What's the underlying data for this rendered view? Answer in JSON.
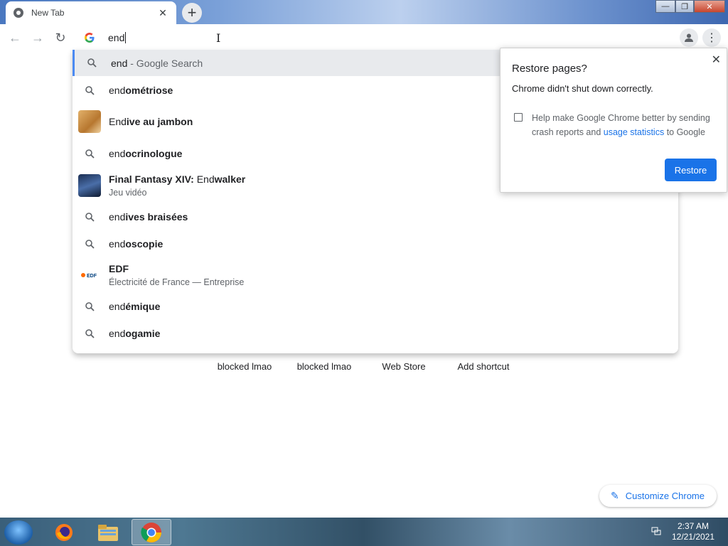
{
  "tab": {
    "title": "New Tab",
    "close": "✕",
    "new_tab": "+"
  },
  "window": {
    "minimize": "—",
    "maximize": "❐",
    "close": "✕"
  },
  "toolbar": {
    "back": "←",
    "forward": "→",
    "reload": "↻",
    "menu": "⋮"
  },
  "omnibox": {
    "value": "end"
  },
  "suggestions": [
    {
      "icon": "search-icon",
      "prefix": "end",
      "bold": "",
      "suffix": " - Google Search",
      "sub": ""
    },
    {
      "icon": "search-icon",
      "prefix": "end",
      "bold": "ométriose",
      "suffix": "",
      "sub": ""
    },
    {
      "icon": "food-thumbnail",
      "prefix": "End",
      "bold": "ive au jambon",
      "suffix": "",
      "sub": ""
    },
    {
      "icon": "search-icon",
      "prefix": "end",
      "bold": "ocrinologue",
      "suffix": "",
      "sub": ""
    },
    {
      "icon": "game-thumbnail",
      "prefix": "Final Fantasy XIV: ",
      "bold": "",
      "suffix": "",
      "bold2_pre": "End",
      "bold2": "walker",
      "sub": "Jeu vidéo"
    },
    {
      "icon": "search-icon",
      "prefix": "end",
      "bold": "ives braisées",
      "suffix": "",
      "sub": ""
    },
    {
      "icon": "search-icon",
      "prefix": "end",
      "bold": "oscopie",
      "suffix": "",
      "sub": ""
    },
    {
      "icon": "edf-logo",
      "prefix": "EDF",
      "bold": "",
      "suffix": "",
      "sub": "Électricité de France — Entreprise"
    },
    {
      "icon": "search-icon",
      "prefix": "end",
      "bold": "émique",
      "suffix": "",
      "sub": ""
    },
    {
      "icon": "search-icon",
      "prefix": "end",
      "bold": "ogamie",
      "suffix": "",
      "sub": ""
    }
  ],
  "shortcuts": [
    "blocked lmao",
    "blocked lmao",
    "Web Store",
    "Add shortcut"
  ],
  "restore_popup": {
    "title": "Restore pages?",
    "message": "Chrome didn't shut down correctly.",
    "help_before": "Help make Google Chrome better by sending crash reports and ",
    "help_link": "usage statistics",
    "help_after": " to Google",
    "restore_button": "Restore",
    "close": "✕",
    "checkbox_checked": false
  },
  "customize": {
    "label": "Customize Chrome"
  },
  "taskbar": {
    "time": "2:37 AM",
    "date": "12/21/2021"
  },
  "colors": {
    "accent": "#1a73e8",
    "selected_row": "#e8eaed",
    "focus_bar": "#4c8af2"
  }
}
